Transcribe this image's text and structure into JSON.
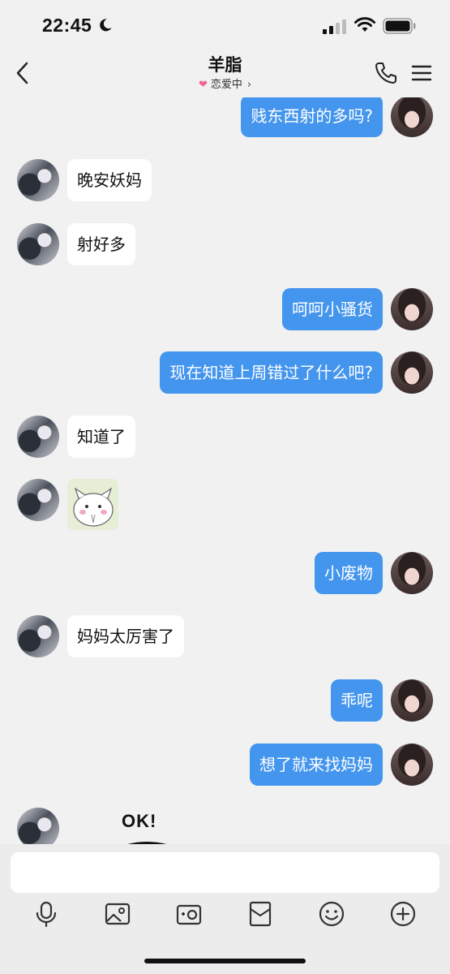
{
  "status_bar": {
    "time": "22:45"
  },
  "header": {
    "title": "羊脂",
    "subtitle": "恋爱中"
  },
  "messages": [
    {
      "side": "out",
      "text": "贱东西射的多吗?"
    },
    {
      "side": "in",
      "text": "晚安妖妈"
    },
    {
      "side": "in",
      "text": "射好多"
    },
    {
      "side": "out",
      "text": "呵呵小骚货"
    },
    {
      "side": "out",
      "text": "现在知道上周错过了什么吧?"
    },
    {
      "side": "in",
      "text": "知道了"
    },
    {
      "side": "in",
      "type": "sticker",
      "icon": "cat-sticker"
    },
    {
      "side": "out",
      "text": "小废物"
    },
    {
      "side": "in",
      "text": "妈妈太厉害了"
    },
    {
      "side": "out",
      "text": "乖呢"
    },
    {
      "side": "out",
      "text": "想了就来找妈妈"
    },
    {
      "side": "in",
      "type": "sticker",
      "icon": "ok-sticker",
      "text": "OK!"
    }
  ],
  "input": {
    "value": "",
    "placeholder": ""
  },
  "toolbar": [
    "microphone-icon",
    "image-icon",
    "camera-icon",
    "red-packet-icon",
    "emoji-icon",
    "plus-icon"
  ],
  "colors": {
    "outgoing_bubble": "#4395ed",
    "incoming_bubble": "#ffffff",
    "background": "#f1f1f1"
  }
}
